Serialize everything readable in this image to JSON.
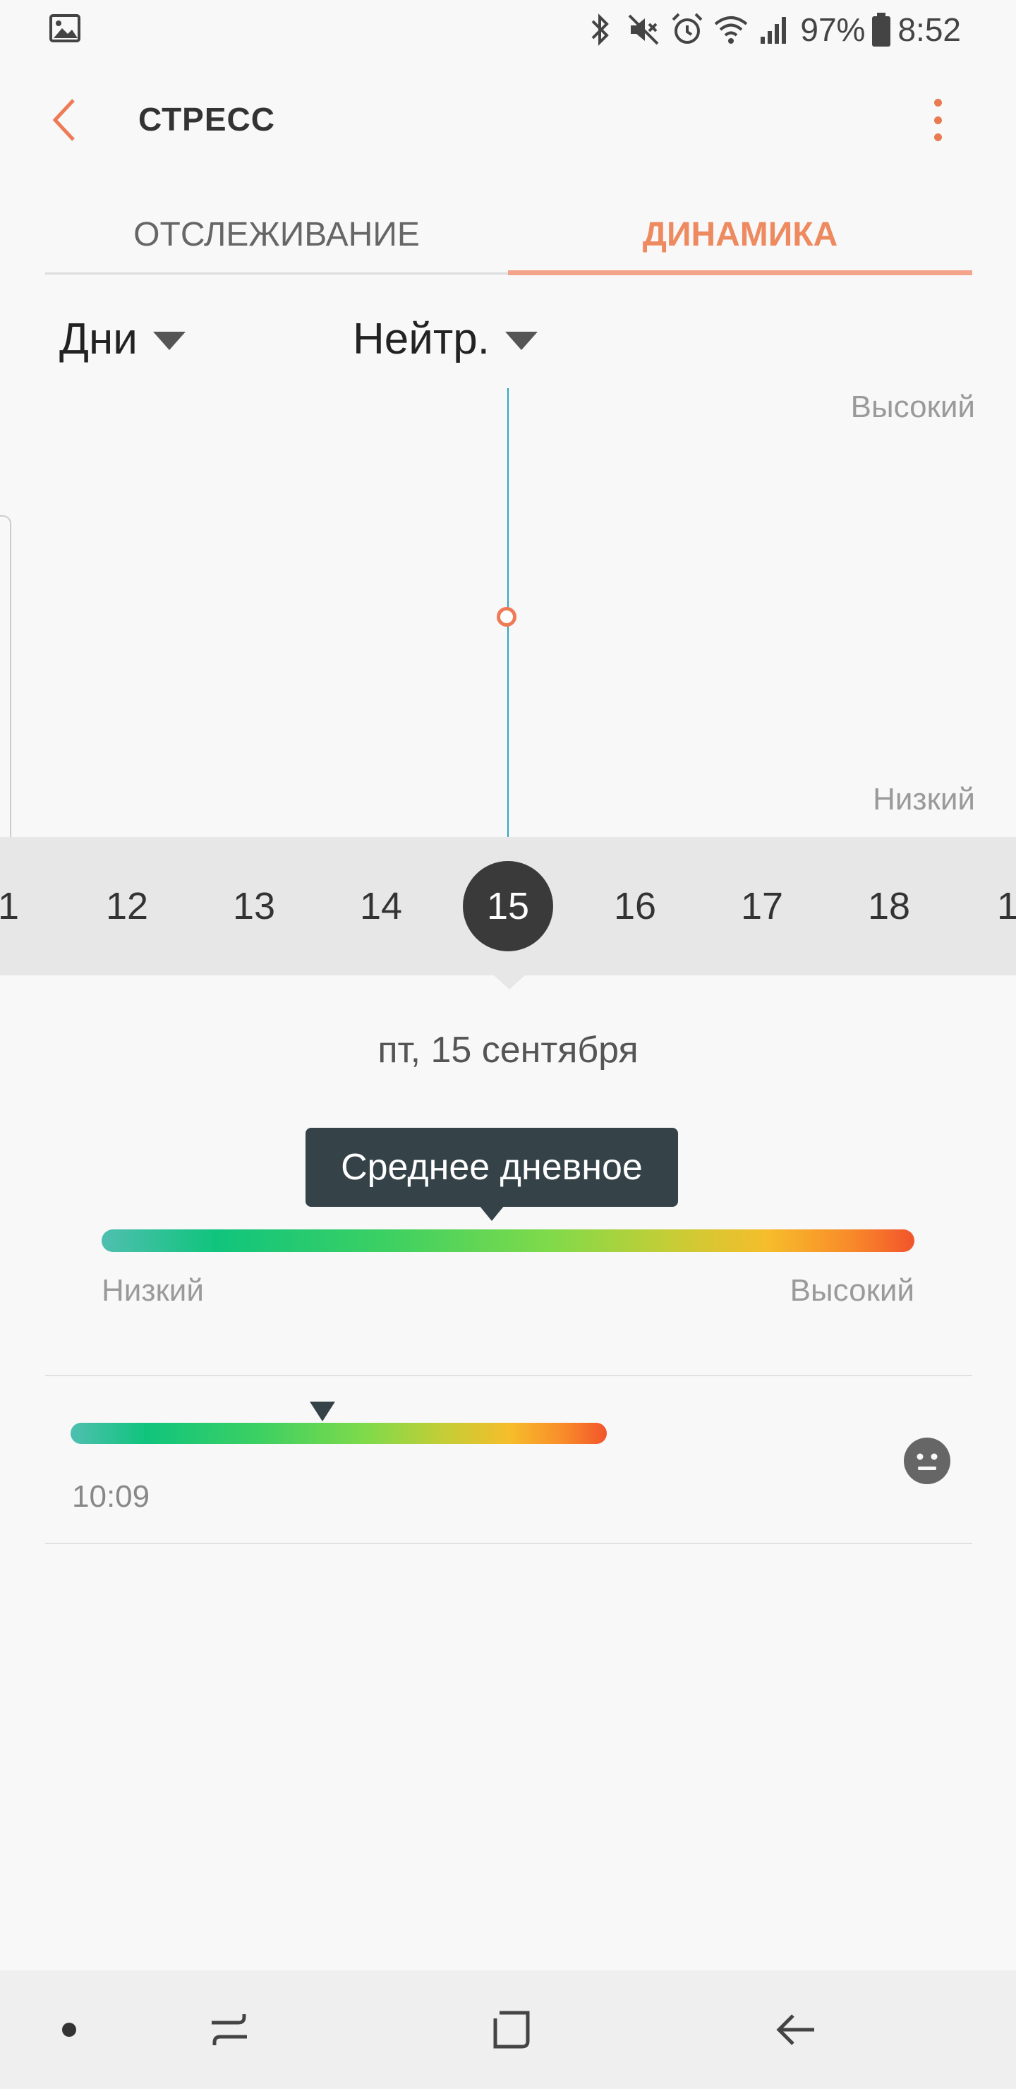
{
  "status_bar": {
    "battery": "97%",
    "time": "8:52",
    "icons": [
      "gallery-icon",
      "bluetooth-icon",
      "mute-icon",
      "alarm-icon",
      "wifi-icon",
      "signal-icon",
      "battery-icon"
    ]
  },
  "header": {
    "title": "СТРЕСС",
    "back_icon": "back-arrow-icon",
    "menu_icon": "more-vert-icon"
  },
  "tabs": [
    {
      "label": "ОТСЛЕЖИВАНИЕ",
      "selected": false
    },
    {
      "label": "ДИНАМИКА",
      "selected": true
    }
  ],
  "filters": {
    "period": "Дни",
    "mode": "Нейтр."
  },
  "chart": {
    "high_label": "Высокий",
    "low_label": "Низкий"
  },
  "days": [
    "1",
    "12",
    "13",
    "14",
    "15",
    "16",
    "17",
    "18",
    "1"
  ],
  "selected_day": "15",
  "detail": {
    "date": "пт, 15 сентября",
    "tooltip": "Среднее дневное",
    "scale_low": "Низкий",
    "scale_high": "Высокий",
    "average_level_fraction": 0.48
  },
  "records": [
    {
      "time": "10:09",
      "level_fraction": 0.47,
      "icon": "neutral-face-icon"
    }
  ],
  "colors": {
    "accent": "#ee8a60",
    "chart_line": "#2aa7c0",
    "tooltip_bg": "#354349",
    "selected_day_bg": "#3a3a3a"
  },
  "nav_bar": {
    "icons": [
      "nav-dot-icon",
      "recents-icon",
      "home-icon",
      "back-icon"
    ]
  }
}
